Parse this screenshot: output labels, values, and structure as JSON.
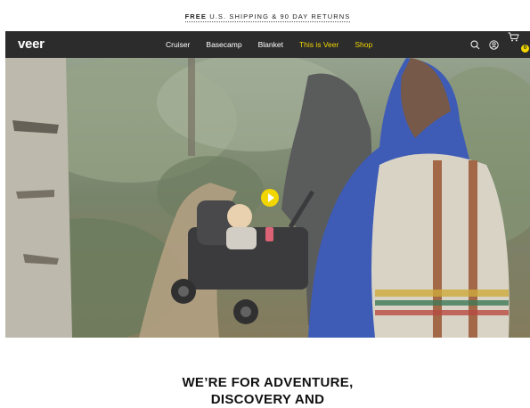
{
  "promo": {
    "bold": "FREE",
    "rest": " U.S. SHIPPING & 90 DAY RETURNS"
  },
  "nav": {
    "logo": "veer",
    "items": [
      {
        "label": "Cruiser",
        "highlight": false
      },
      {
        "label": "Basecamp",
        "highlight": false
      },
      {
        "label": "Blanket",
        "highlight": false
      },
      {
        "label": "This is Veer",
        "highlight": true
      },
      {
        "label": "Shop",
        "highlight": true
      }
    ],
    "icons": [
      "search-icon",
      "account-icon",
      "cart-icon"
    ],
    "cart_count": "0"
  },
  "colors": {
    "accent": "#f2d600",
    "nav_bg": "#2c2c2c"
  },
  "hero": {
    "play_icon": "play-icon"
  },
  "headline": {
    "line1": "WE’RE FOR ADVENTURE,",
    "line2": "DISCOVERY AND"
  }
}
